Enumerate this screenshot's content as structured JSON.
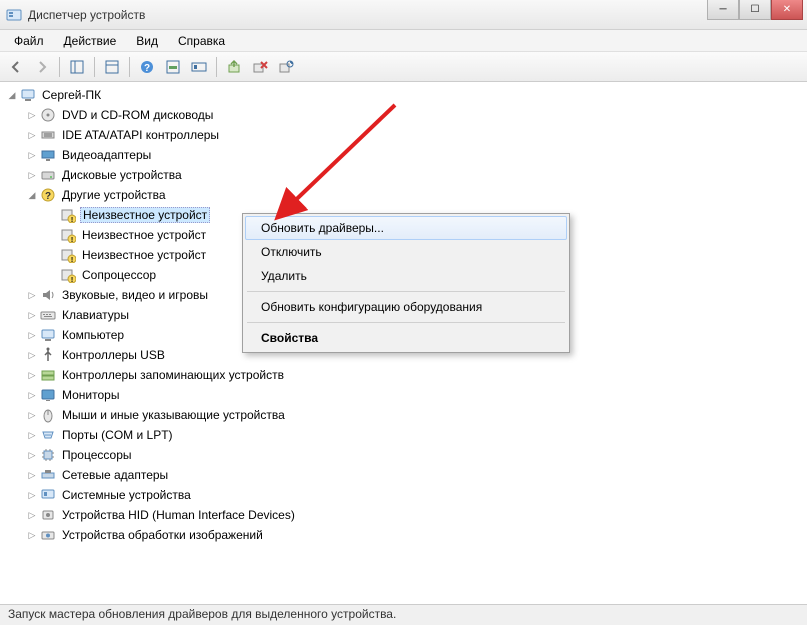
{
  "window": {
    "title": "Диспетчер устройств"
  },
  "menu": {
    "file": "Файл",
    "action": "Действие",
    "view": "Вид",
    "help": "Справка"
  },
  "tree": {
    "root": "Сергей-ПК",
    "cdrom": "DVD и CD-ROM дисководы",
    "ide": "IDE ATA/ATAPI контроллеры",
    "video": "Видеоадаптеры",
    "disk": "Дисковые устройства",
    "other": "Другие устройства",
    "unknown1": "Неизвестное устройст",
    "unknown2": "Неизвестное устройст",
    "unknown3": "Неизвестное устройст",
    "coproc": "Сопроцессор",
    "sound": "Звуковые, видео и игровы",
    "keyboard": "Клавиатуры",
    "computer": "Компьютер",
    "usb": "Контроллеры USB",
    "storage": "Контроллеры запоминающих устройств",
    "monitor": "Мониторы",
    "mouse": "Мыши и иные указывающие устройства",
    "ports": "Порты (COM и LPT)",
    "cpu": "Процессоры",
    "network": "Сетевые адаптеры",
    "system": "Системные устройства",
    "hid": "Устройства HID (Human Interface Devices)",
    "imaging": "Устройства обработки изображений"
  },
  "context_menu": {
    "update": "Обновить драйверы...",
    "disable": "Отключить",
    "delete": "Удалить",
    "scan": "Обновить конфигурацию оборудования",
    "properties": "Свойства"
  },
  "statusbar": "Запуск мастера обновления драйверов для выделенного устройства."
}
